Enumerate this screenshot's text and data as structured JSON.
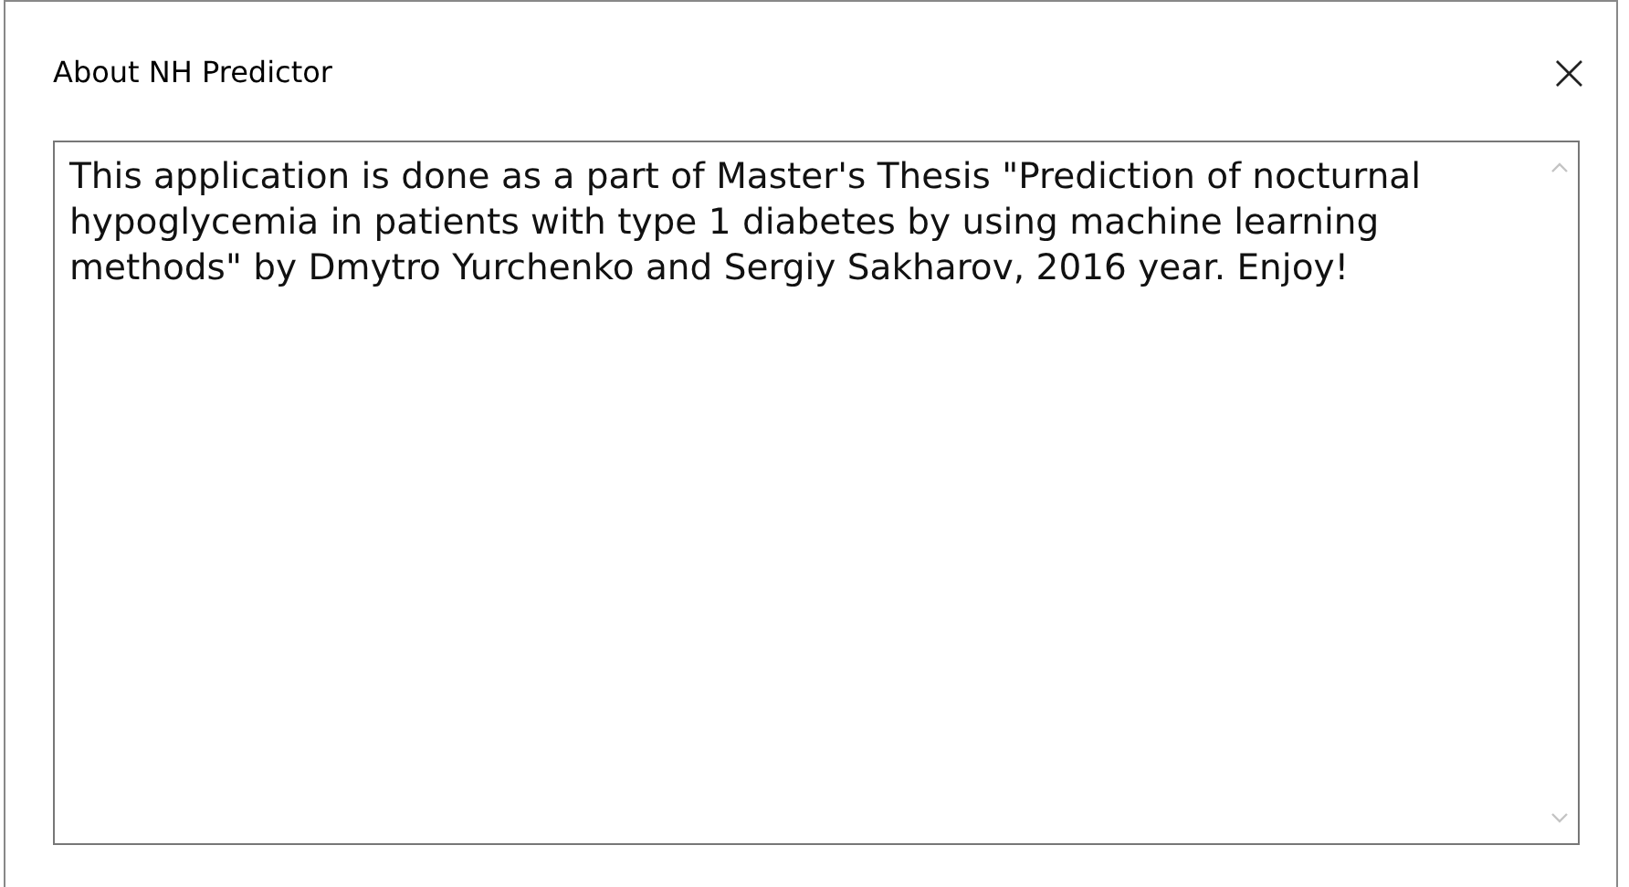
{
  "window": {
    "title": "About NH Predictor",
    "close": "×"
  },
  "text_area": {
    "value": "This application is done as a part of Master's Thesis \"Prediction of nocturnal hypoglycemia in patients with type 1 diabetes by using machine learning methods\" by Dmytro Yurchenko and Sergiy Sakharov, 2016 year. Enjoy!"
  }
}
